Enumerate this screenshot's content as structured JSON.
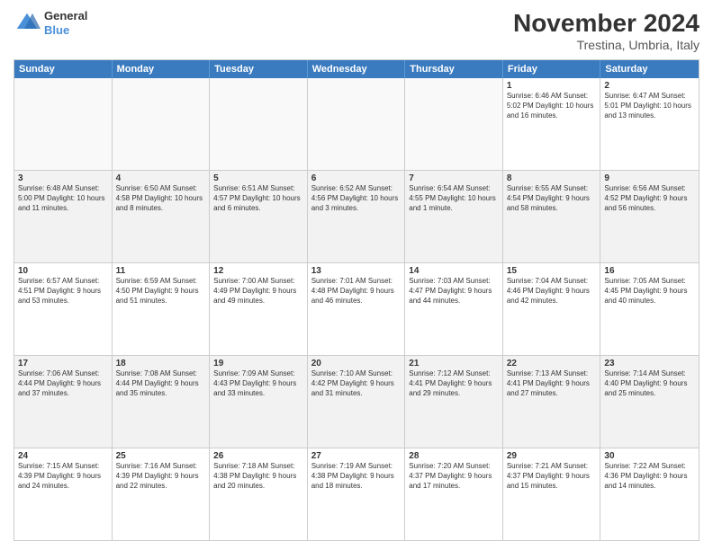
{
  "header": {
    "logo": {
      "general": "General",
      "blue": "Blue"
    },
    "month_title": "November 2024",
    "subtitle": "Trestina, Umbria, Italy"
  },
  "weekdays": [
    "Sunday",
    "Monday",
    "Tuesday",
    "Wednesday",
    "Thursday",
    "Friday",
    "Saturday"
  ],
  "rows": [
    {
      "alt": false,
      "cells": [
        {
          "day": "",
          "info": ""
        },
        {
          "day": "",
          "info": ""
        },
        {
          "day": "",
          "info": ""
        },
        {
          "day": "",
          "info": ""
        },
        {
          "day": "",
          "info": ""
        },
        {
          "day": "1",
          "info": "Sunrise: 6:46 AM\nSunset: 5:02 PM\nDaylight: 10 hours and 16 minutes."
        },
        {
          "day": "2",
          "info": "Sunrise: 6:47 AM\nSunset: 5:01 PM\nDaylight: 10 hours and 13 minutes."
        }
      ]
    },
    {
      "alt": true,
      "cells": [
        {
          "day": "3",
          "info": "Sunrise: 6:48 AM\nSunset: 5:00 PM\nDaylight: 10 hours and 11 minutes."
        },
        {
          "day": "4",
          "info": "Sunrise: 6:50 AM\nSunset: 4:58 PM\nDaylight: 10 hours and 8 minutes."
        },
        {
          "day": "5",
          "info": "Sunrise: 6:51 AM\nSunset: 4:57 PM\nDaylight: 10 hours and 6 minutes."
        },
        {
          "day": "6",
          "info": "Sunrise: 6:52 AM\nSunset: 4:56 PM\nDaylight: 10 hours and 3 minutes."
        },
        {
          "day": "7",
          "info": "Sunrise: 6:54 AM\nSunset: 4:55 PM\nDaylight: 10 hours and 1 minute."
        },
        {
          "day": "8",
          "info": "Sunrise: 6:55 AM\nSunset: 4:54 PM\nDaylight: 9 hours and 58 minutes."
        },
        {
          "day": "9",
          "info": "Sunrise: 6:56 AM\nSunset: 4:52 PM\nDaylight: 9 hours and 56 minutes."
        }
      ]
    },
    {
      "alt": false,
      "cells": [
        {
          "day": "10",
          "info": "Sunrise: 6:57 AM\nSunset: 4:51 PM\nDaylight: 9 hours and 53 minutes."
        },
        {
          "day": "11",
          "info": "Sunrise: 6:59 AM\nSunset: 4:50 PM\nDaylight: 9 hours and 51 minutes."
        },
        {
          "day": "12",
          "info": "Sunrise: 7:00 AM\nSunset: 4:49 PM\nDaylight: 9 hours and 49 minutes."
        },
        {
          "day": "13",
          "info": "Sunrise: 7:01 AM\nSunset: 4:48 PM\nDaylight: 9 hours and 46 minutes."
        },
        {
          "day": "14",
          "info": "Sunrise: 7:03 AM\nSunset: 4:47 PM\nDaylight: 9 hours and 44 minutes."
        },
        {
          "day": "15",
          "info": "Sunrise: 7:04 AM\nSunset: 4:46 PM\nDaylight: 9 hours and 42 minutes."
        },
        {
          "day": "16",
          "info": "Sunrise: 7:05 AM\nSunset: 4:45 PM\nDaylight: 9 hours and 40 minutes."
        }
      ]
    },
    {
      "alt": true,
      "cells": [
        {
          "day": "17",
          "info": "Sunrise: 7:06 AM\nSunset: 4:44 PM\nDaylight: 9 hours and 37 minutes."
        },
        {
          "day": "18",
          "info": "Sunrise: 7:08 AM\nSunset: 4:44 PM\nDaylight: 9 hours and 35 minutes."
        },
        {
          "day": "19",
          "info": "Sunrise: 7:09 AM\nSunset: 4:43 PM\nDaylight: 9 hours and 33 minutes."
        },
        {
          "day": "20",
          "info": "Sunrise: 7:10 AM\nSunset: 4:42 PM\nDaylight: 9 hours and 31 minutes."
        },
        {
          "day": "21",
          "info": "Sunrise: 7:12 AM\nSunset: 4:41 PM\nDaylight: 9 hours and 29 minutes."
        },
        {
          "day": "22",
          "info": "Sunrise: 7:13 AM\nSunset: 4:41 PM\nDaylight: 9 hours and 27 minutes."
        },
        {
          "day": "23",
          "info": "Sunrise: 7:14 AM\nSunset: 4:40 PM\nDaylight: 9 hours and 25 minutes."
        }
      ]
    },
    {
      "alt": false,
      "cells": [
        {
          "day": "24",
          "info": "Sunrise: 7:15 AM\nSunset: 4:39 PM\nDaylight: 9 hours and 24 minutes."
        },
        {
          "day": "25",
          "info": "Sunrise: 7:16 AM\nSunset: 4:39 PM\nDaylight: 9 hours and 22 minutes."
        },
        {
          "day": "26",
          "info": "Sunrise: 7:18 AM\nSunset: 4:38 PM\nDaylight: 9 hours and 20 minutes."
        },
        {
          "day": "27",
          "info": "Sunrise: 7:19 AM\nSunset: 4:38 PM\nDaylight: 9 hours and 18 minutes."
        },
        {
          "day": "28",
          "info": "Sunrise: 7:20 AM\nSunset: 4:37 PM\nDaylight: 9 hours and 17 minutes."
        },
        {
          "day": "29",
          "info": "Sunrise: 7:21 AM\nSunset: 4:37 PM\nDaylight: 9 hours and 15 minutes."
        },
        {
          "day": "30",
          "info": "Sunrise: 7:22 AM\nSunset: 4:36 PM\nDaylight: 9 hours and 14 minutes."
        }
      ]
    }
  ]
}
